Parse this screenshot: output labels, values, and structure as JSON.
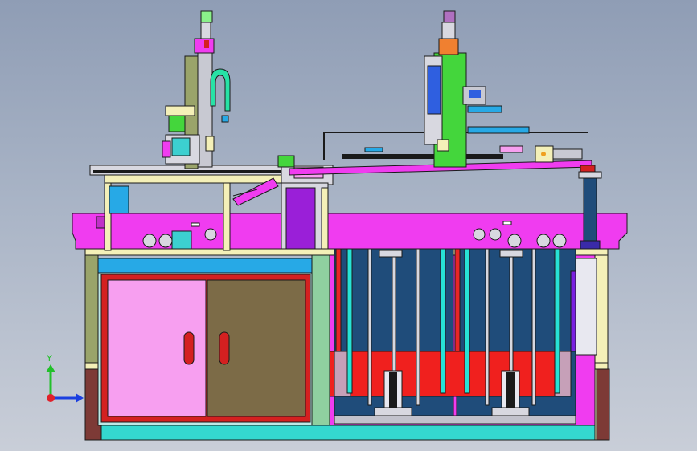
{
  "viewport": {
    "axis_triad": {
      "y_label": "Y",
      "x_label": "",
      "y_color": "#22c02a",
      "x_color": "#1b3fe0",
      "z_color": "#e0202a"
    }
  },
  "palette": {
    "frame_magenta": "#f03cf0",
    "frame_cyan": "#27e2d6",
    "pale_yellow": "#f4f0b8",
    "cabinet_red": "#d42020",
    "door_pink": "#f79ff0",
    "door_olive": "#7c6b47",
    "navy_panel": "#1f4c7a",
    "red_mold": "#f0201e",
    "gantry_green": "#44d63c",
    "blue_block": "#2f5fe0",
    "purple_column": "#9a1fd8",
    "outline": "#1a1a1a"
  }
}
